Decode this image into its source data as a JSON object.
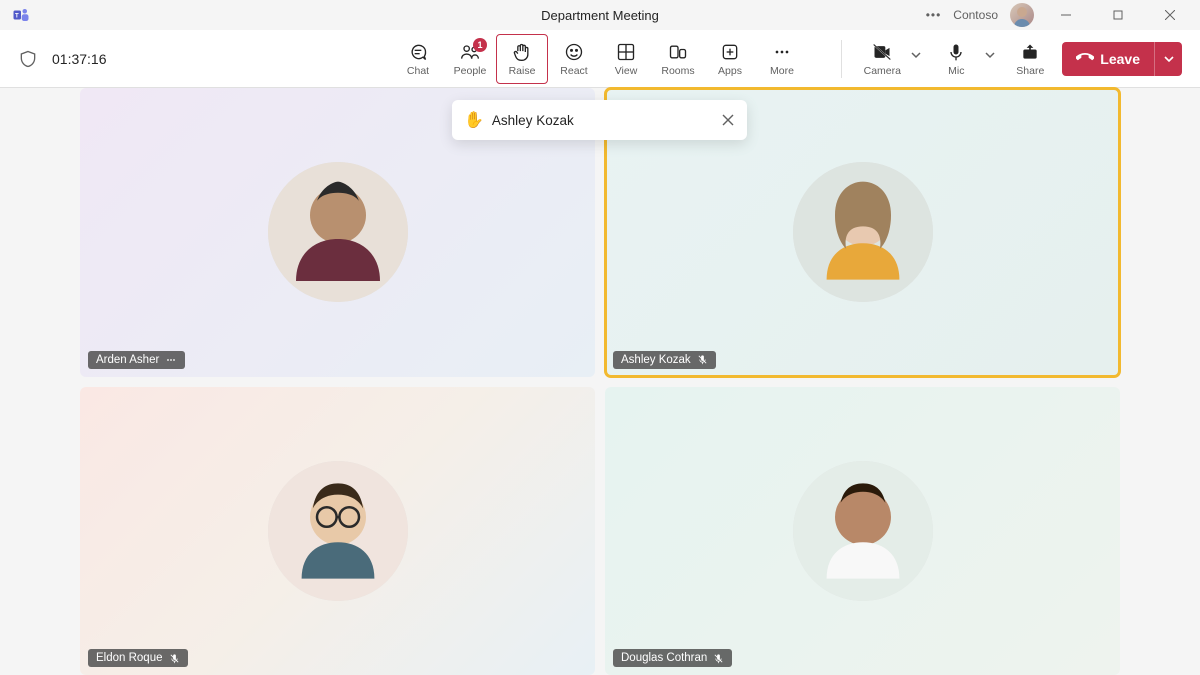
{
  "titlebar": {
    "title": "Department Meeting",
    "org": "Contoso"
  },
  "toolbar": {
    "timer": "01:37:16",
    "chat": "Chat",
    "people": "People",
    "people_badge": "1",
    "raise": "Raise",
    "react": "React",
    "view": "View",
    "rooms": "Rooms",
    "apps": "Apps",
    "more": "More",
    "camera": "Camera",
    "mic": "Mic",
    "share": "Share",
    "leave": "Leave"
  },
  "toast": {
    "icon": "✋",
    "name": "Ashley Kozak"
  },
  "participants": [
    {
      "name": "Arden Asher",
      "muted": false,
      "more": true,
      "raised": false
    },
    {
      "name": "Ashley Kozak",
      "muted": true,
      "more": false,
      "raised": true
    },
    {
      "name": "Eldon Roque",
      "muted": true,
      "more": false,
      "raised": false
    },
    {
      "name": "Douglas Cothran",
      "muted": true,
      "more": false,
      "raised": false
    }
  ]
}
